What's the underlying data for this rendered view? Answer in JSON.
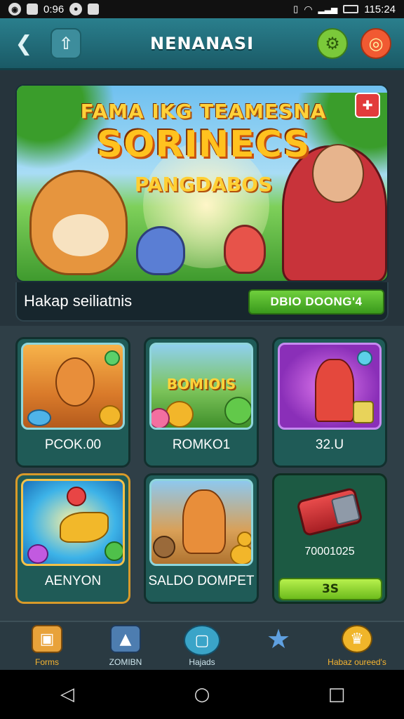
{
  "status_bar": {
    "time_left": "0:96",
    "time_right": "115:24"
  },
  "header": {
    "title": "NENANASI",
    "back_icon": "back-chevron-icon",
    "up_icon": "arrow-up-icon",
    "settings_icon": "gear-icon",
    "notif_icon": "notification-icon"
  },
  "banner": {
    "line1": "FAMA IKG TEAMESNA",
    "line2": "SORINECS",
    "line3": "PANGDABOS"
  },
  "info_strip": {
    "label": "Hakap seiliatnis",
    "button_label": "DBIO DOONG'4"
  },
  "cards": [
    {
      "label": "PCOK.00"
    },
    {
      "label": "ROMKO1",
      "thumb_text": "BOMIOIS"
    },
    {
      "label": "32.U"
    },
    {
      "label": "AENYON"
    },
    {
      "label": "SALDO DOMPET"
    },
    {
      "value": "70001025",
      "button_label": "3S"
    }
  ],
  "bottom_nav": [
    {
      "label": "Forms",
      "icon": "home-chest-icon"
    },
    {
      "label": "ZOMIBN",
      "icon": "shirt-icon"
    },
    {
      "label": "Hajads",
      "icon": "shield-icon"
    },
    {
      "label": "",
      "icon": "star-icon"
    },
    {
      "label": "Habaz oureed's",
      "icon": "trophy-icon"
    }
  ],
  "colors": {
    "header": "#2a7f8d",
    "accent_green": "#6fcf3d",
    "nav_active": "#f7b531",
    "card_bg": "#1f5b57"
  }
}
